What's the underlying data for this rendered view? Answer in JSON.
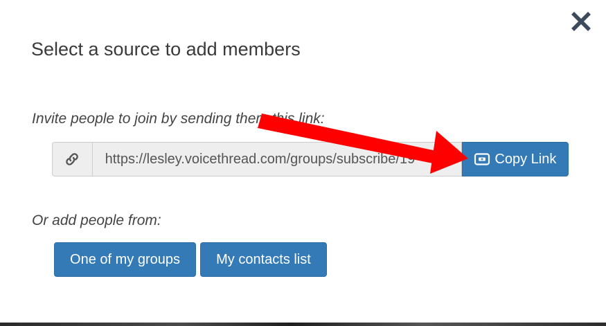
{
  "dialog": {
    "title": "Select a source to add members",
    "close_icon": "close-icon"
  },
  "invite": {
    "prompt": "Invite people to join by sending them this link:",
    "link_icon": "link-icon",
    "link_value": "https://lesley.voicethread.com/groups/subscribe/19",
    "copy_button_icon": "copy-link-icon",
    "copy_button_label": "Copy Link"
  },
  "add_from": {
    "prompt": "Or add people from:",
    "groups_button_label": "One of my groups",
    "contacts_button_label": "My contacts list"
  },
  "colors": {
    "primary": "#337ab7",
    "primary_border": "#2e6da4",
    "annotation_arrow": "#ff0000",
    "close_icon": "#3d4a5c"
  }
}
